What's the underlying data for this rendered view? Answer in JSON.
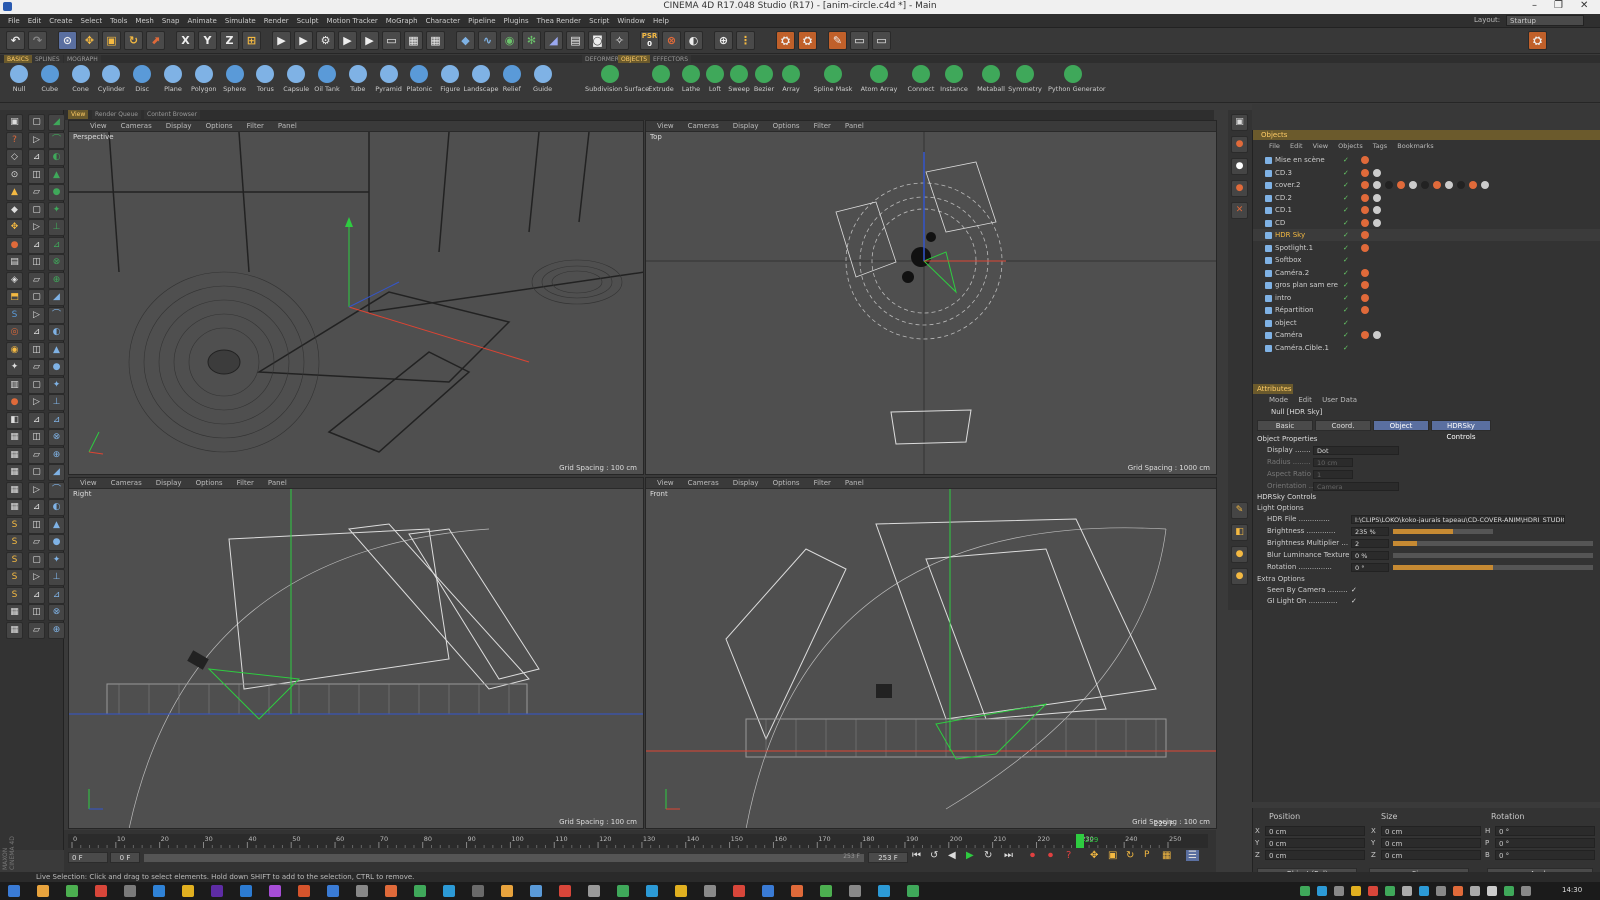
{
  "window": {
    "title": "CINEMA 4D R17.048 Studio (R17) - [anim-circle.c4d *] - Main"
  },
  "menu": [
    "File",
    "Edit",
    "Create",
    "Select",
    "Tools",
    "Mesh",
    "Snap",
    "Animate",
    "Simulate",
    "Render",
    "Sculpt",
    "Motion Tracker",
    "MoGraph",
    "Character",
    "Pipeline",
    "Plugins",
    "Thea Render",
    "Script",
    "Window",
    "Help"
  ],
  "layout": {
    "label": "Layout:",
    "value": "Startup"
  },
  "toolbar": {
    "undo": "↶",
    "x": "X",
    "y": "Y",
    "z": "Z",
    "psr": "PSR",
    "psr_val": "0"
  },
  "palette_tabs": [
    "BASICS",
    "SPLINES",
    "MOGRAPH"
  ],
  "generator_tabs": [
    "DEFORMERS",
    "OBJECTS",
    "EFFECTORS"
  ],
  "basic_objects": [
    "Null",
    "Cube",
    "Cone",
    "Cylinder",
    "Disc",
    "Plane",
    "Polygon",
    "Sphere",
    "Torus",
    "Capsule",
    "Oil Tank",
    "Tube",
    "Pyramid",
    "Platonic",
    "Figure",
    "Landscape",
    "Relief",
    "Guide"
  ],
  "generators": [
    "Subdivision Surface",
    "Extrude",
    "Lathe",
    "Loft",
    "Sweep",
    "Bezier",
    "Array",
    "Spline Mask",
    "Atom Array",
    "Connect",
    "Instance",
    "Metaball",
    "Symmetry",
    "Python Generator"
  ],
  "viewport_tabs": [
    "View",
    "Render Queue",
    "Content Browser"
  ],
  "viewport_menu": [
    "View",
    "Cameras",
    "Display",
    "Options",
    "Filter",
    "Panel"
  ],
  "viewports": {
    "perspective": {
      "name": "Perspective",
      "grid": "Grid Spacing : 100 cm"
    },
    "top": {
      "name": "Top",
      "grid": "Grid Spacing : 1000 cm"
    },
    "right": {
      "name": "Right",
      "grid": "Grid Spacing : 100 cm"
    },
    "front": {
      "name": "Front",
      "grid": "Grid Spacing : 100 cm"
    }
  },
  "objects_panel": {
    "title": "Objects",
    "menu": [
      "File",
      "Edit",
      "View",
      "Objects",
      "Tags",
      "Bookmarks"
    ],
    "items": [
      "Mise en scène",
      "CD.3",
      "cover.2",
      "CD.2",
      "CD.1",
      "CD",
      "HDR Sky",
      "Spotlight.1",
      "Softbox",
      "Caméra.2",
      "gros plan sam ere",
      "intro",
      "Répartition",
      "object",
      "Caméra",
      "Caméra.Cible.1"
    ]
  },
  "attributes": {
    "title": "Attributes",
    "menu": [
      "Mode",
      "Edit",
      "User Data"
    ],
    "object_name": "Null [HDR Sky]",
    "tabs": [
      "Basic",
      "Coord.",
      "Object",
      "HDRSky Controls"
    ],
    "object_properties": "Object Properties",
    "display_label": "Display .......",
    "display_value": "Dot",
    "radius_label": "Radius ........",
    "radius_value": "10 cm",
    "aspect_label": "Aspect Ratio ...",
    "aspect_value": "1",
    "orientation_label": "Orientation ....",
    "orientation_value": "Camera",
    "hdrsky_controls": "HDRSky Controls",
    "light_options": "Light Options",
    "hdr_file_label": "HDR File ..............",
    "hdr_file_value": "I:\\CLIPS\\LOKO\\koko-jaurais tapeau\\CD-COVER-ANIM\\HDRI_STUDIO_vol",
    "brightness_label": "Brightness .............",
    "brightness_value": "235 %",
    "brightness_fill": 0.6,
    "mult_label": "Brightness Multiplier ...",
    "mult_value": "2",
    "mult_fill": 0.12,
    "blur_label": "Blur Luminance Texture",
    "blur_value": "0 %",
    "blur_fill": 0.0,
    "rotation_label": "Rotation ...............",
    "rotation_value": "0 °",
    "rotation_fill": 0.5,
    "extra_options": "Extra Options",
    "seen_label": "Seen By Camera .........",
    "gi_label": "GI Light On .............",
    "check": "✓"
  },
  "coords": {
    "headers": [
      "Position",
      "Size",
      "Rotation"
    ],
    "x": [
      "X",
      "0 cm",
      "X",
      "0 cm",
      "H",
      "0 °"
    ],
    "y": [
      "Y",
      "0 cm",
      "Y",
      "0 cm",
      "P",
      "0 °"
    ],
    "z": [
      "Z",
      "0 cm",
      "Z",
      "0 cm",
      "B",
      "0 °"
    ],
    "mode": "Object (Rel)",
    "size_mode": "Size",
    "apply": "Apply"
  },
  "timeline": {
    "ticks": [
      "0",
      "10",
      "20",
      "30",
      "40",
      "50",
      "60",
      "70",
      "80",
      "90",
      "100",
      "110",
      "120",
      "130",
      "140",
      "150",
      "160",
      "170",
      "180",
      "190",
      "200",
      "210",
      "220",
      "230",
      "240",
      "250"
    ],
    "current": "229",
    "current_frac": 0.916,
    "end_field": "229 F",
    "start_field": "0 F",
    "min_field": "0 F",
    "max_field": "253 F",
    "max_small": "253 F"
  },
  "status": "Live Selection: Click and drag to select elements. Hold down SHIFT to add to the selection, CTRL to remove.",
  "maxon": "MAXON CINEMA 4D",
  "clock": "14:30"
}
